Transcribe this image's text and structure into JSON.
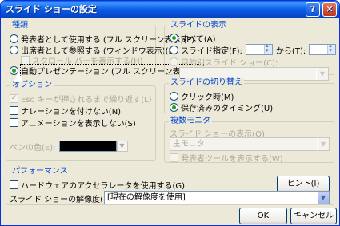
{
  "window": {
    "title": "スライド ショーの設定",
    "help": "?",
    "close": "✕"
  },
  "type_group": {
    "title": "種類",
    "presenter": "発表者として使用する (フル スクリーン表示)(P)",
    "browsed": "出席者として参照する (ウィンドウ表示)(B)",
    "scrollbar": "スクロール バーを表示する(H)",
    "kiosk": "自動プレゼンテーション (フル スクリーン表示)(K)"
  },
  "options_group": {
    "title": "オプション",
    "loop": "Esc キーが押されるまで繰り返す(L)",
    "no_narration": "ナレーションを付けない(N)",
    "no_animation": "アニメーションを表示しない(S)",
    "pen_color_label": "ペンの色(E):"
  },
  "slides_group": {
    "title": "スライドの表示",
    "all": "すべて(A)",
    "from": "スライド指定(F):",
    "to": "から(T):",
    "custom_show": "目的別スライド ショー(C):"
  },
  "advance_group": {
    "title": "スライドの切り替え",
    "manual": "クリック時(M)",
    "timings": "保存済みのタイミング(U)"
  },
  "monitors_group": {
    "title": "複数モニタ",
    "display_on": "スライド ショーの表示(O):",
    "primary_monitor": "主モニタ",
    "presenter_tools": "発表者ツールを表示する(W)"
  },
  "performance_group": {
    "title": "パフォーマンス",
    "hw_accel": "ハードウェアのアクセラレータを使用する(G)",
    "tips": "ヒント(I)",
    "resolution_label": "スライド ショーの解像度(R):",
    "resolution_value": "[現在の解像度を使用]"
  },
  "buttons": {
    "ok": "OK",
    "cancel": "キャンセル"
  },
  "colors": {
    "title_bar": "#0b5be5",
    "group_title": "#0046d5",
    "face": "#ece9d8"
  }
}
